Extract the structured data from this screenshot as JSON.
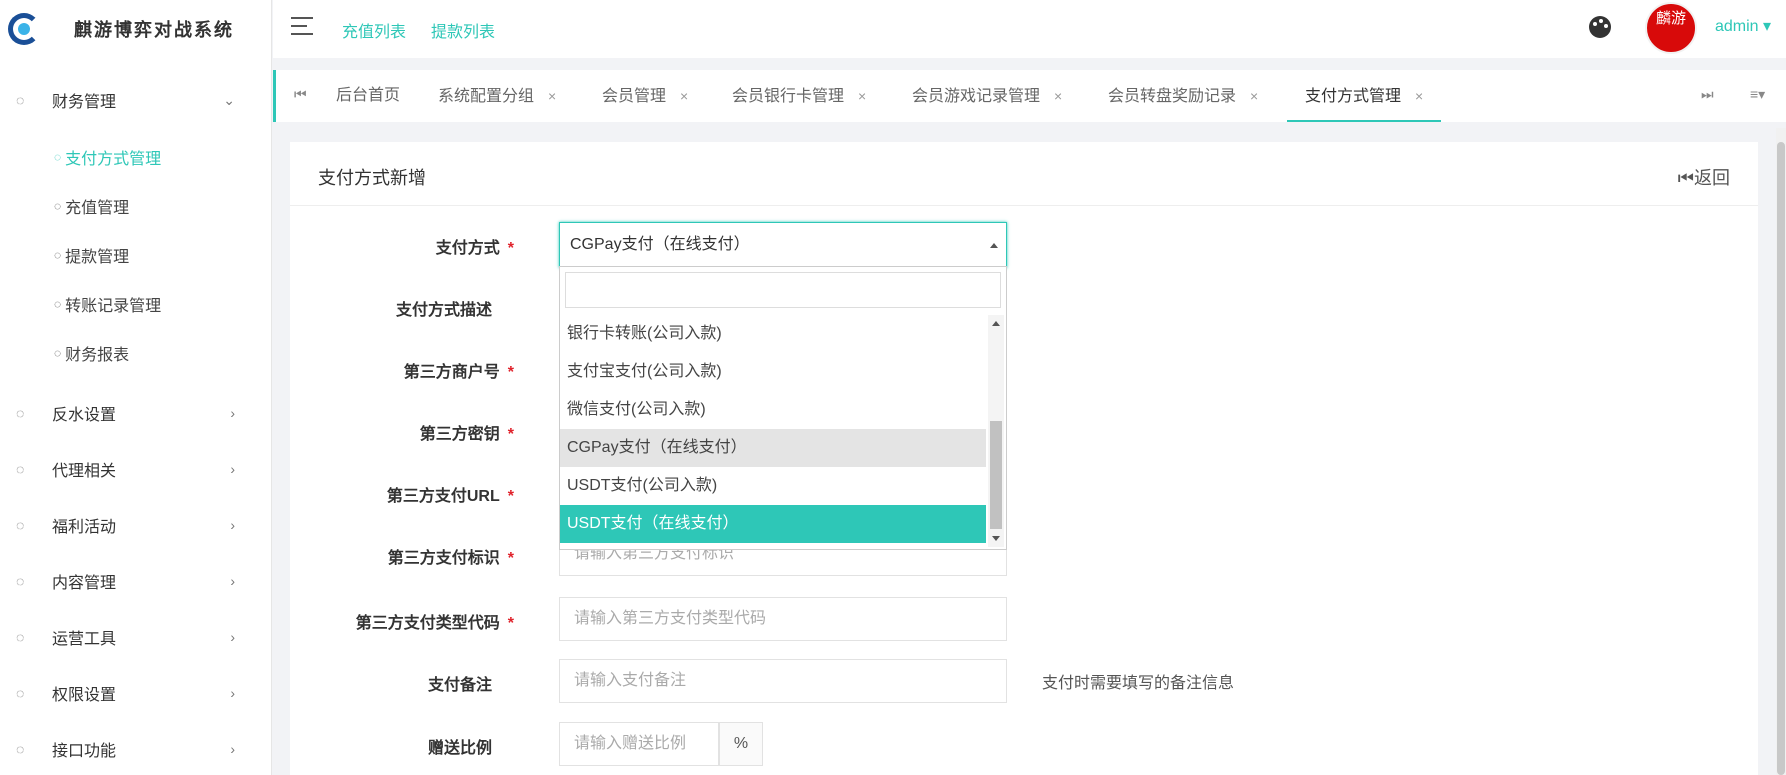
{
  "app": {
    "title": "麒游博弈对战系统"
  },
  "header": {
    "links": [
      "充值列表",
      "提款列表"
    ],
    "avatar_text": "麟游",
    "user": "admin ▾"
  },
  "sidebar": {
    "finance": {
      "label": "财务管理",
      "items": [
        "支付方式管理",
        "充值管理",
        "提款管理",
        "转账记录管理",
        "财务报表"
      ]
    },
    "groups": [
      "反水设置",
      "代理相关",
      "福利活动",
      "内容管理",
      "运营工具",
      "权限设置",
      "接口功能"
    ]
  },
  "tabs": [
    {
      "label": "后台首页",
      "closable": false
    },
    {
      "label": "系统配置分组",
      "closable": true
    },
    {
      "label": "会员管理",
      "closable": true
    },
    {
      "label": "会员银行卡管理",
      "closable": true
    },
    {
      "label": "会员游戏记录管理",
      "closable": true
    },
    {
      "label": "会员转盘奖励记录",
      "closable": true
    },
    {
      "label": "支付方式管理",
      "closable": true,
      "active": true
    }
  ],
  "card": {
    "title": "支付方式新增",
    "back": "⏮返回"
  },
  "form": {
    "pay_method": {
      "label": "支付方式",
      "value": "CGPay支付（在线支付）"
    },
    "pay_desc": {
      "label": "支付方式描述"
    },
    "merchant_no": {
      "label": "第三方商户号"
    },
    "secret": {
      "label": "第三方密钥"
    },
    "pay_url": {
      "label": "第三方支付URL"
    },
    "pay_flag": {
      "label": "第三方支付标识",
      "placeholder": "请输入第三方支付标识"
    },
    "pay_type_code": {
      "label": "第三方支付类型代码",
      "placeholder": "请输入第三方支付类型代码"
    },
    "pay_note": {
      "label": "支付备注",
      "placeholder": "请输入支付备注",
      "help": "支付时需要填写的备注信息"
    },
    "bonus_ratio": {
      "label": "赠送比例",
      "placeholder": "请输入赠送比例",
      "unit": "%"
    }
  },
  "dropdown": {
    "options": [
      "银行卡转账(公司入款)",
      "支付宝支付(公司入款)",
      "微信支付(公司入款)",
      "CGPay支付（在线支付）",
      "USDT支付(公司入款)",
      "USDT支付（在线支付）"
    ],
    "selected_index": 3,
    "highlight_index": 5
  },
  "colors": {
    "accent": "#2ec7b7",
    "required": "#e0222b"
  }
}
